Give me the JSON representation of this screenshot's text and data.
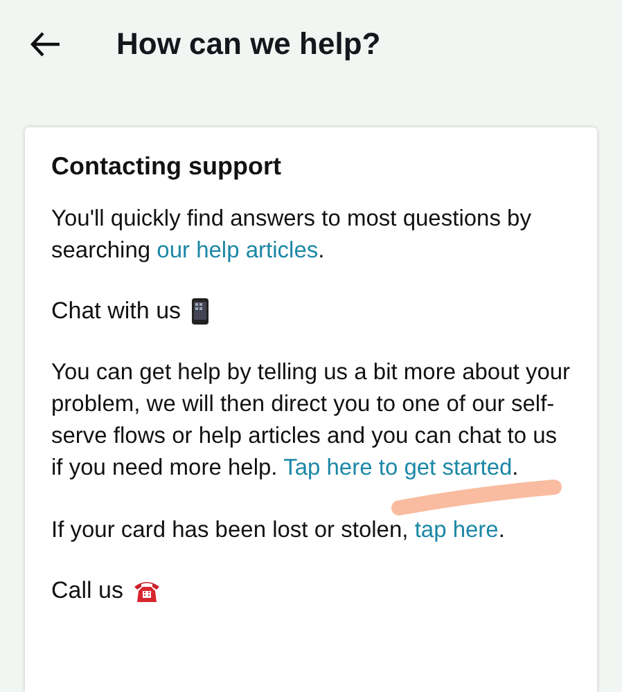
{
  "header": {
    "title": "How can we help?"
  },
  "card": {
    "title": "Contacting support",
    "blocks": [
      {
        "kind": "text",
        "before": "You'll quickly find answers to most questions by searching ",
        "link": "our help articles",
        "after": "."
      },
      {
        "kind": "chat",
        "text": "Chat with us"
      },
      {
        "kind": "text",
        "before": "You can get help by telling us a bit more about your problem, we will then direct you to one of our self-serve flows or help articles and you can chat to us if you need more help. ",
        "link": "Tap here to get started",
        "after": "."
      },
      {
        "kind": "text",
        "before": "If your card has been lost or stolen, ",
        "link": "tap here",
        "after": "."
      },
      {
        "kind": "call",
        "text": "Call us"
      }
    ]
  }
}
